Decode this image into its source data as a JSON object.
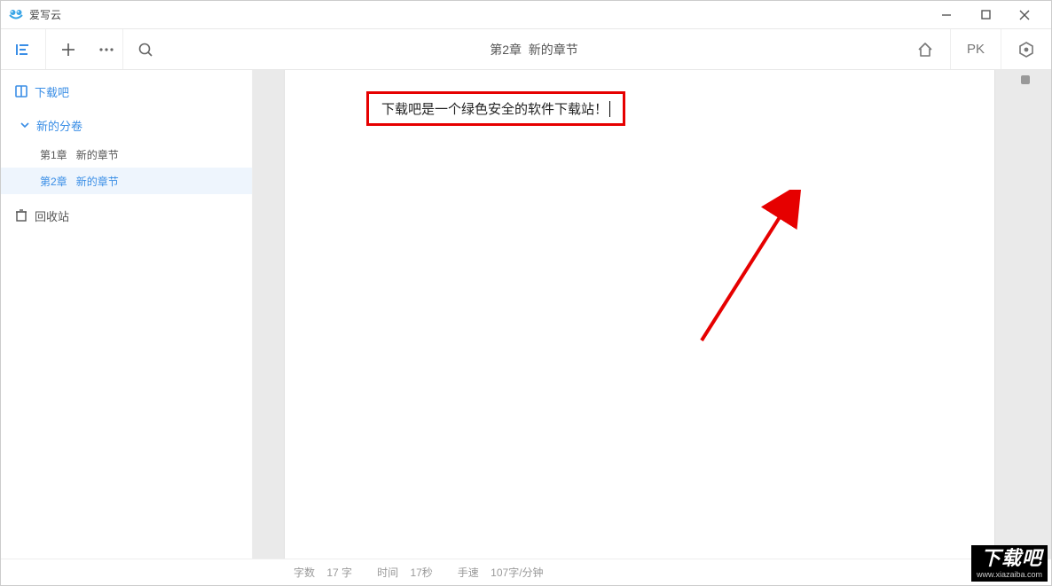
{
  "app": {
    "title": "爱写云"
  },
  "toolbar": {
    "chapter_title_prefix": "第2章",
    "chapter_title_name": "新的章节",
    "pk_label": "PK"
  },
  "sidebar": {
    "book": {
      "label": "下载吧"
    },
    "volume": {
      "label": "新的分卷"
    },
    "chapters": [
      {
        "num": "第1章",
        "name": "新的章节",
        "active": false
      },
      {
        "num": "第2章",
        "name": "新的章节",
        "active": true
      }
    ],
    "trash": {
      "label": "回收站"
    }
  },
  "editor": {
    "highlighted_text": "下载吧是一个绿色安全的软件下载站！"
  },
  "statusbar": {
    "wordcount_label": "字数",
    "wordcount_value": "17 字",
    "time_label": "时间",
    "time_value": "17秒",
    "speed_label": "手速",
    "speed_value": "107字/分钟"
  },
  "watermark": {
    "top": "下载吧",
    "bot": "www.xiazaiba.com"
  }
}
